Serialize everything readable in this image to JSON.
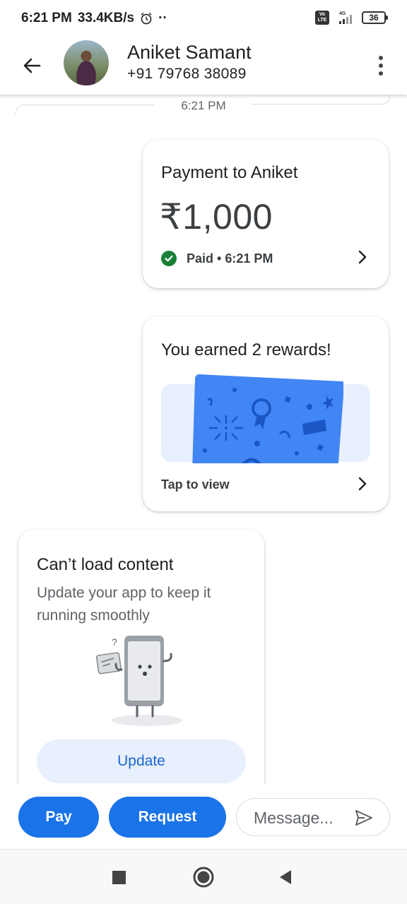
{
  "status_bar": {
    "time": "6:21 PM",
    "speed": "33.4KB/s",
    "dots": "··",
    "network": "4G",
    "volte": "Vo LTE",
    "battery": "36"
  },
  "header": {
    "contact_name": "Aniket Samant",
    "contact_phone": "+91 79768 38089"
  },
  "chat": {
    "time_separator": "6:21 PM",
    "payment_card": {
      "title": "Payment to Aniket",
      "amount": "₹1,000",
      "status": "Paid • 6:21 PM"
    },
    "reward_card": {
      "title": "You earned 2 rewards!",
      "action": "Tap to view"
    },
    "update_card": {
      "title": "Can’t load content",
      "body": "Update your app to keep it running smoothly",
      "button": "Update"
    }
  },
  "composer": {
    "pay_label": "Pay",
    "request_label": "Request",
    "message_placeholder": "Message..."
  },
  "colors": {
    "primary_blue": "#1a73e8",
    "paid_green": "#188038",
    "light_blue_bg": "#e8f0fe",
    "reward_ticket_blue": "#4285f4"
  },
  "icons": [
    "back-arrow-icon",
    "more-vert-icon",
    "check-circle-icon",
    "chevron-right-icon",
    "send-icon",
    "nav-recent-icon",
    "nav-home-icon",
    "nav-back-icon",
    "alarm-icon",
    "signal-icon",
    "battery-icon"
  ]
}
